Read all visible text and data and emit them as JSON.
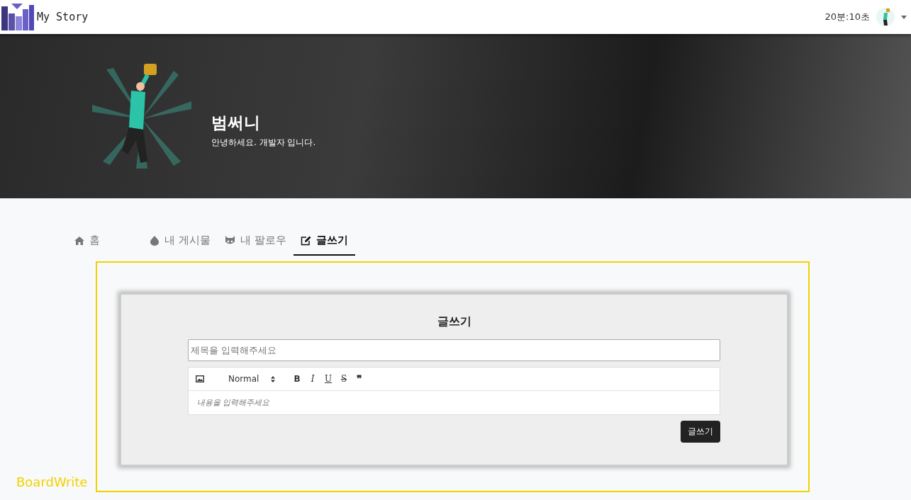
{
  "header": {
    "logo_text": "My Story",
    "timer": "20분:10초"
  },
  "profile": {
    "name": "범써니",
    "greeting": "안녕하세요. 개발자 입니다."
  },
  "tabs": [
    {
      "label": "홈",
      "selected": false
    },
    {
      "label": "내 게시물",
      "selected": false
    },
    {
      "label": "내 팔로우",
      "selected": false
    },
    {
      "label": "글쓰기",
      "selected": true
    }
  ],
  "component_label": "BoardWrite",
  "form": {
    "title": "글쓰기",
    "title_placeholder": "제목을 입력해주세요",
    "format": "Normal",
    "toolbar": [
      "B",
      "I",
      "U",
      "S",
      "❞"
    ],
    "content_placeholder": "내용을 입력해주세요",
    "submit": "글쓰기"
  }
}
